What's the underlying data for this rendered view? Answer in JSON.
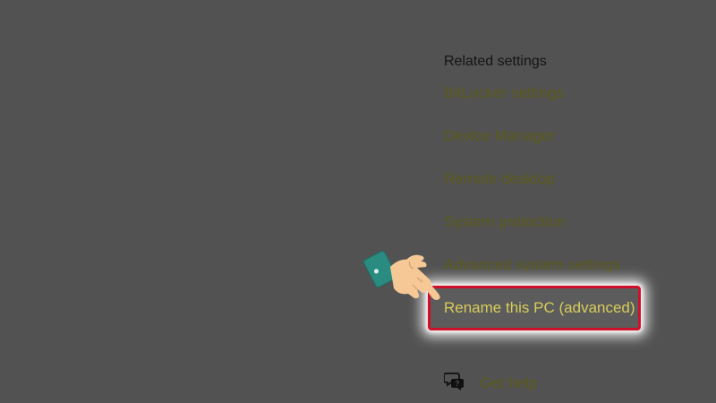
{
  "related_settings": {
    "heading": "Related settings",
    "links": [
      {
        "label": "BitLocker settings"
      },
      {
        "label": "Device Manager"
      },
      {
        "label": "Remote desktop"
      },
      {
        "label": "System protection"
      },
      {
        "label": "Advanced system settings"
      },
      {
        "label": "Rename this PC (advanced)"
      }
    ]
  },
  "help": {
    "label": "Get help",
    "icon": "chat-bubbles-icon"
  },
  "annotation": {
    "pointer_icon": "pointing-hand-icon",
    "highlight_color": "#d0102a"
  },
  "colors": {
    "background": "#525252",
    "link": "#5a5a1a",
    "link_highlighted": "#d8cc5a",
    "heading": "#141414"
  }
}
